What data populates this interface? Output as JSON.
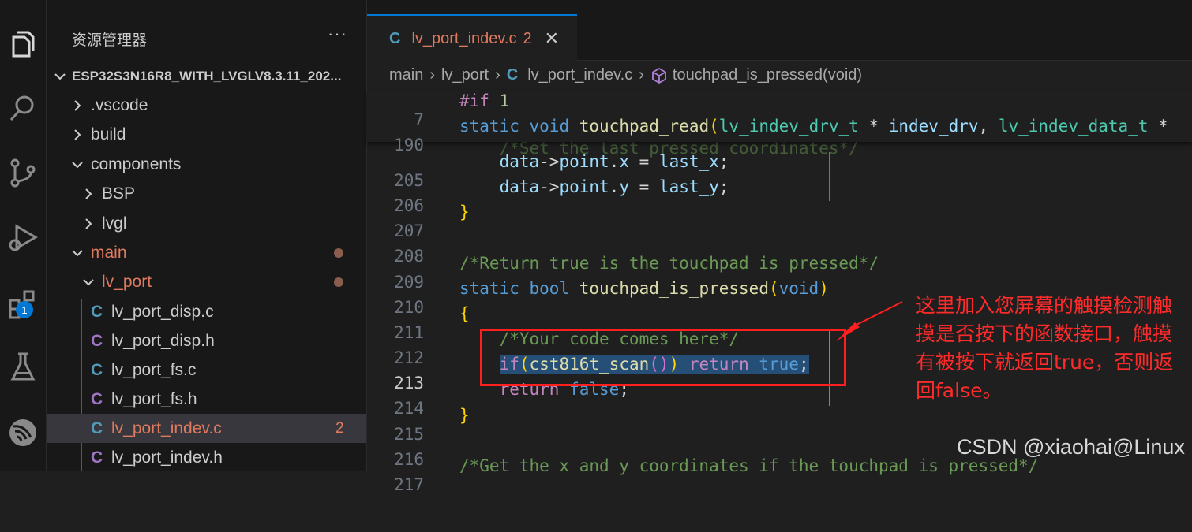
{
  "sidebar": {
    "title": "资源管理器",
    "more": "···",
    "project": "ESP32S3N16R8_WITH_LVGLV8.3.11_202...",
    "items": [
      {
        "label": ".vscode",
        "type": "folder",
        "state": "collapsed"
      },
      {
        "label": "build",
        "type": "folder",
        "state": "collapsed"
      },
      {
        "label": "components",
        "type": "folder",
        "state": "expanded"
      },
      {
        "label": "BSP",
        "type": "folder",
        "state": "collapsed"
      },
      {
        "label": "lvgl",
        "type": "folder",
        "state": "collapsed"
      },
      {
        "label": "main",
        "type": "folder",
        "state": "expanded"
      },
      {
        "label": "lv_port",
        "type": "folder",
        "state": "expanded"
      },
      {
        "label": "lv_port_disp.c",
        "type": "file",
        "icon": "C"
      },
      {
        "label": "lv_port_disp.h",
        "type": "file",
        "icon": "C"
      },
      {
        "label": "lv_port_fs.c",
        "type": "file",
        "icon": "C"
      },
      {
        "label": "lv_port_fs.h",
        "type": "file",
        "icon": "C"
      },
      {
        "label": "lv_port_indev.c",
        "type": "file",
        "icon": "C",
        "count": "2"
      },
      {
        "label": "lv_port_indev.h",
        "type": "file",
        "icon": "C"
      }
    ]
  },
  "activity": {
    "extensions_badge": "1"
  },
  "tab": {
    "icon": "C",
    "name": "lv_port_indev.c",
    "count": "2",
    "close": "✕"
  },
  "breadcrumb": {
    "p1": "main",
    "p2": "lv_port",
    "icon": "C",
    "p3": "lv_port_indev.c",
    "p4": "touchpad_is_pressed(void)",
    "sep": "›"
  },
  "sticky": [
    {
      "num": "7",
      "text": "#if 1"
    },
    {
      "num": "190",
      "text": "static void touchpad_read(lv_indev_drv_t * indev_drv, lv_indev_data_t *"
    }
  ],
  "code_lines": [
    {
      "num": "205",
      "text": "    data->point.x = last_x;"
    },
    {
      "num": "206",
      "text": "    data->point.y = last_y;"
    },
    {
      "num": "207",
      "text": "}"
    },
    {
      "num": "208",
      "text": ""
    },
    {
      "num": "209",
      "text": "/*Return true is the touchpad is pressed*/"
    },
    {
      "num": "210",
      "text": "static bool touchpad_is_pressed(void)"
    },
    {
      "num": "211",
      "text": "{"
    },
    {
      "num": "212",
      "text": "    /*Your code comes here*/"
    },
    {
      "num": "213",
      "text": "    if(cst816t_scan()) return true;"
    },
    {
      "num": "214",
      "text": "    return false;"
    },
    {
      "num": "215",
      "text": "}"
    },
    {
      "num": "216",
      "text": ""
    },
    {
      "num": "217",
      "text": "/*Get the x and y coordinates if the touchpad is pressed*/"
    }
  ],
  "annotation": "这里加入您屏幕的触摸检测触摸是否按下的函数接口，触摸有被按下就返回true，否则返回false。",
  "watermark": "CSDN @xiaohai@Linux",
  "colors": {
    "keyword": "#569cd6",
    "function": "#dcdcaa",
    "type": "#4ec9b0",
    "comment": "#6a9955",
    "annotation": "#ff2a2a",
    "accent": "#0078d4"
  }
}
